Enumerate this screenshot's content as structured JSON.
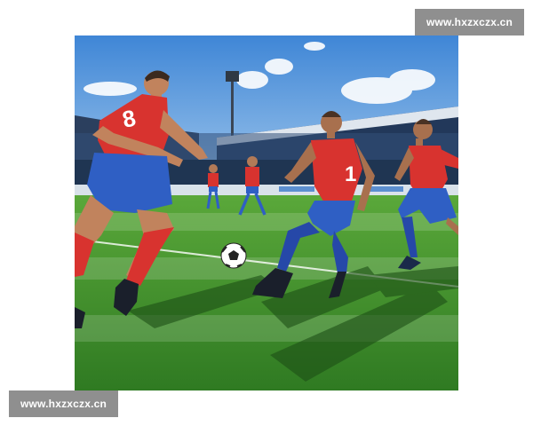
{
  "watermarks": {
    "top_right": "www.hxzxczx.cn",
    "bottom_left": "www.hxzxczx.cn"
  },
  "photo": {
    "jersey_numbers": [
      "8",
      "1"
    ]
  }
}
